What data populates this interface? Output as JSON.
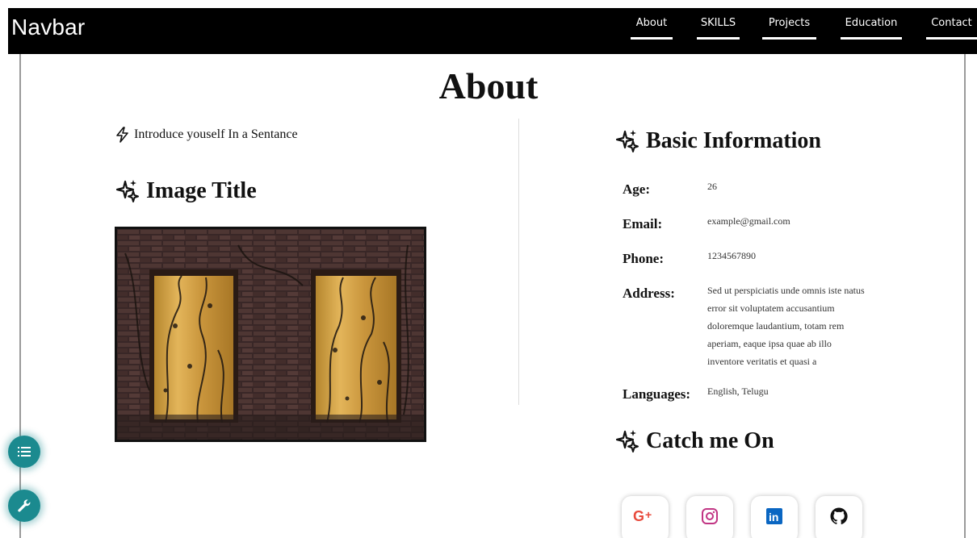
{
  "navbar": {
    "brand": "Navbar",
    "links": [
      {
        "label": "About"
      },
      {
        "label": "SKILLS"
      },
      {
        "label": "Projects"
      },
      {
        "label": "Education"
      },
      {
        "label": "Contact"
      }
    ]
  },
  "about": {
    "title": "About",
    "intro": "Introduce youself In a Sentance",
    "image_heading": "Image Title"
  },
  "basic_info": {
    "heading": "Basic Information",
    "age_label": "Age:",
    "age": "26",
    "email_label": "Email:",
    "email": "example@gmail.com",
    "phone_label": "Phone:",
    "phone": "1234567890",
    "address_label": "Address:",
    "address_lines": [
      "Sed ut perspiciatis unde omnis iste natus",
      "error sit voluptatem accusantium",
      "doloremque laudantium, totam rem",
      "aperiam, eaque ipsa quae ab illo",
      "inventore veritatis et quasi a"
    ],
    "languages_label": "Languages:",
    "languages": "English, Telugu"
  },
  "catch_me": {
    "heading": "Catch me On",
    "icons": [
      "google-plus-icon",
      "instagram-icon",
      "linkedin-icon",
      "github-icon"
    ]
  },
  "floating_buttons": [
    "list-icon",
    "wrench-icon"
  ],
  "colors": {
    "navbar_bg": "#000000",
    "fab": "#1b8a8f",
    "google": "#e84a3c",
    "instagram": "#c13584",
    "linkedin": "#0a66c2",
    "github": "#111111"
  }
}
